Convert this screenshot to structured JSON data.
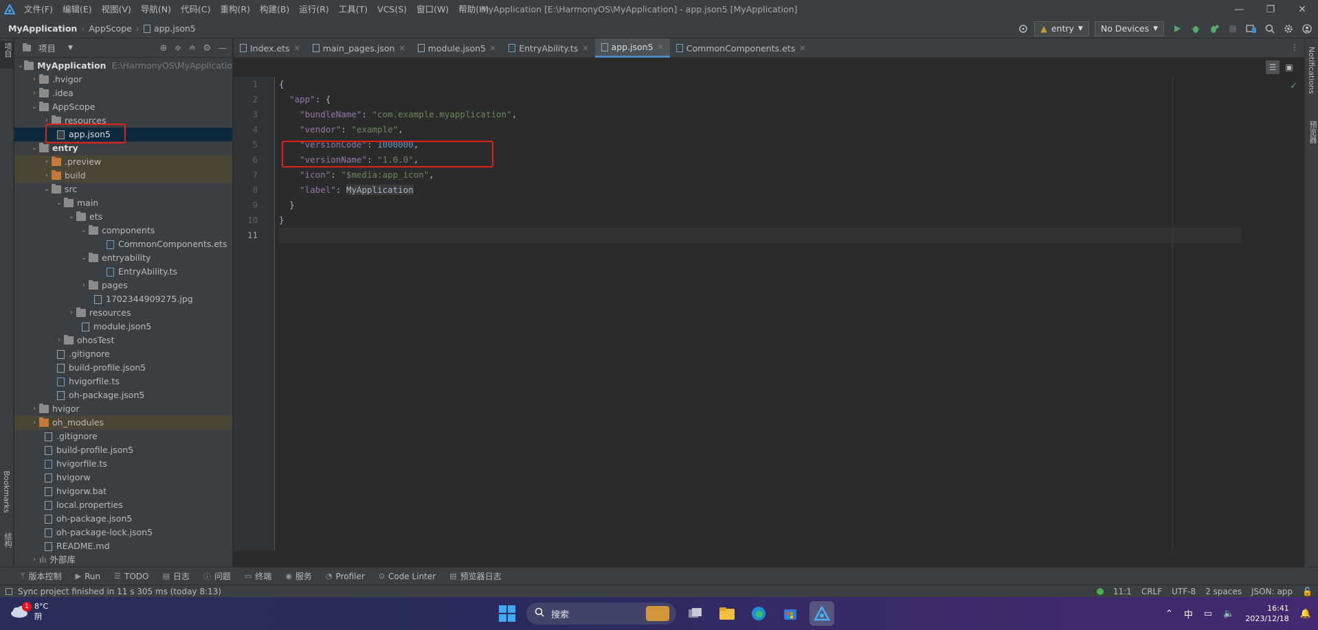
{
  "window": {
    "title": "MyApplication [E:\\HarmonyOS\\MyApplication] - app.json5 [MyApplication]",
    "controls": {
      "minimize": "—",
      "restore": "❐",
      "close": "✕"
    }
  },
  "menu": [
    "文件(F)",
    "编辑(E)",
    "视图(V)",
    "导航(N)",
    "代码(C)",
    "重构(R)",
    "构建(B)",
    "运行(R)",
    "工具(T)",
    "VCS(S)",
    "窗口(W)",
    "帮助(H)"
  ],
  "breadcrumb": [
    "MyApplication",
    "AppScope",
    "app.json5"
  ],
  "toolbar": {
    "module": "entry",
    "device": "No Devices"
  },
  "left_strip": {
    "project": "项目",
    "bookmarks": "Bookmarks",
    "structure": "结构"
  },
  "right_strip": {
    "notifications": "Notifications",
    "preview": "预览器"
  },
  "project_panel": {
    "title": "项目",
    "tree": [
      {
        "label": "MyApplication",
        "hint": "E:\\HarmonyOS\\MyApplicatio"
      },
      {
        "label": ".hvigor"
      },
      {
        "label": ".idea"
      },
      {
        "label": "AppScope"
      },
      {
        "label": "resources"
      },
      {
        "label": "app.json5"
      },
      {
        "label": "entry"
      },
      {
        "label": ".preview"
      },
      {
        "label": "build"
      },
      {
        "label": "src"
      },
      {
        "label": "main"
      },
      {
        "label": "ets"
      },
      {
        "label": "components"
      },
      {
        "label": "CommonComponents.ets"
      },
      {
        "label": "entryability"
      },
      {
        "label": "EntryAbility.ts"
      },
      {
        "label": "pages"
      },
      {
        "label": "1702344909275.jpg"
      },
      {
        "label": "resources"
      },
      {
        "label": "module.json5"
      },
      {
        "label": "ohosTest"
      },
      {
        "label": ".gitignore"
      },
      {
        "label": "build-profile.json5"
      },
      {
        "label": "hvigorfile.ts"
      },
      {
        "label": "oh-package.json5"
      },
      {
        "label": "hvigor"
      },
      {
        "label": "oh_modules"
      },
      {
        "label": ".gitignore"
      },
      {
        "label": "build-profile.json5"
      },
      {
        "label": "hvigorfile.ts"
      },
      {
        "label": "hvigorw"
      },
      {
        "label": "hvigorw.bat"
      },
      {
        "label": "local.properties"
      },
      {
        "label": "oh-package.json5"
      },
      {
        "label": "oh-package-lock.json5"
      },
      {
        "label": "README.md"
      },
      {
        "label": "外部库"
      }
    ]
  },
  "tabs": [
    "Index.ets",
    "main_pages.json",
    "module.json5",
    "EntryAbility.ts",
    "app.json5",
    "CommonComponents.ets"
  ],
  "editor": {
    "line_numbers": [
      "1",
      "2",
      "3",
      "4",
      "5",
      "6",
      "7",
      "8",
      "9",
      "10",
      "11"
    ],
    "lines": {
      "l1": "{",
      "l2_key": "\"app\"",
      "l2_rest": ": {",
      "l3_key": "\"bundleName\"",
      "l3_val": "\"com.example.myapplication\"",
      "l4_key": "\"vendor\"",
      "l4_val": "\"example\"",
      "l5_key": "\"versionCode\"",
      "l5_val": "1000000",
      "l6_key": "\"versionName\"",
      "l6_val": "\"1.0.0\"",
      "l7_key": "\"icon\"",
      "l7_val": "\"$media:app_icon\"",
      "l8_key": "\"label\"",
      "l8_val": "MyApplication",
      "l9": "}",
      "l10": "}"
    }
  },
  "bottom_tools": [
    "版本控制",
    "Run",
    "TODO",
    "日志",
    "问题",
    "终端",
    "服务",
    "Profiler",
    "Code Linter",
    "预览器日志"
  ],
  "status": {
    "message": "Sync project finished in 11 s 305 ms (today 8:13)",
    "position": "11:1",
    "line_sep": "CRLF",
    "encoding": "UTF-8",
    "indent": "2 spaces",
    "file_type": "JSON: app"
  },
  "taskbar": {
    "weather_temp": "8°C",
    "weather_desc": "阴",
    "weather_badge": "1",
    "search_placeholder": "搜索",
    "ime": "中",
    "time": "16:41",
    "date": "2023/12/18"
  },
  "colors": {
    "accent": "#4a88c7",
    "highlight": "#e0201b"
  }
}
